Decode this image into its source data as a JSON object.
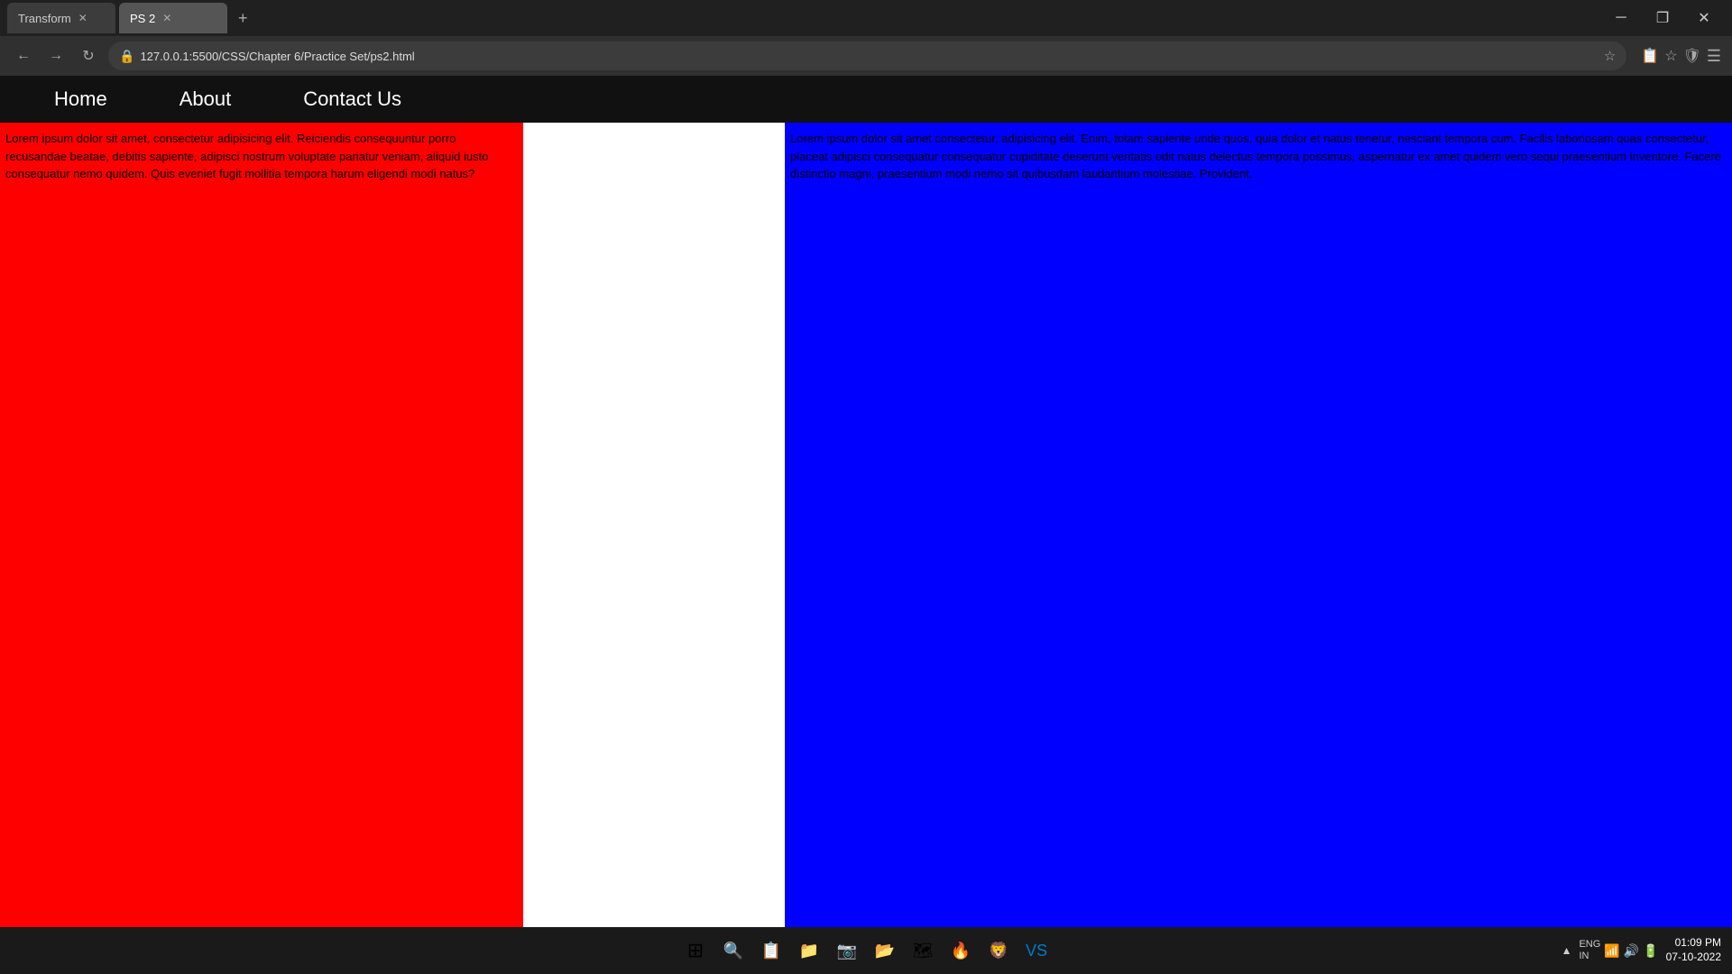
{
  "browser": {
    "tabs": [
      {
        "id": "tab1",
        "label": "Transform",
        "active": false
      },
      {
        "id": "tab2",
        "label": "PS 2",
        "active": true
      }
    ],
    "url": "127.0.0.1:5500/CSS/Chapter 6/Practice Set/ps2.html",
    "window_controls": [
      "─",
      "❐",
      "✕"
    ]
  },
  "nav": {
    "links": [
      {
        "label": "Home"
      },
      {
        "label": "About"
      },
      {
        "label": "Contact Us"
      }
    ]
  },
  "columns": {
    "red": {
      "text": "Lorem ipsum dolor sit amet, consectetur adipisicing elit. Reiciendis consequuntur porro recusandae beatae, debitis sapiente, adipisci nostrum voluptate pariatur veniam, aliquid iusto consequatur nemo quidem. Quis eveniet fugit mollitia tempora harum eligendi modi natus?"
    },
    "white": {
      "text": ""
    },
    "blue": {
      "text": "Lorem ipsum dolor sit amet consectetur, adipisicing elit. Enim, totam sapiente unde quos, quia dolor et natus tenetur, nesciant tempora cum. Facilis laboriosam quas consectetur, placeat adipisci consequatur consequatur cupiditate deserunt veritatis odit natus delectus tempora possimus, aspernatur ex amet quidem vero sequi praesentium inventore. Facere distinctio magni, praesentium modi nemo sit quibusdam laudantium molestiae. Provident."
    }
  },
  "taskbar": {
    "icons": [
      "⊞",
      "🔍",
      "📁",
      "📷",
      "📂",
      "🗺",
      "🔥",
      "🛡",
      "📝"
    ],
    "sys_icons": [
      "▲",
      "ENG\nIN",
      "📶",
      "🔊",
      "⏱"
    ],
    "time": "01:09 PM",
    "date": "07-10-2022"
  }
}
